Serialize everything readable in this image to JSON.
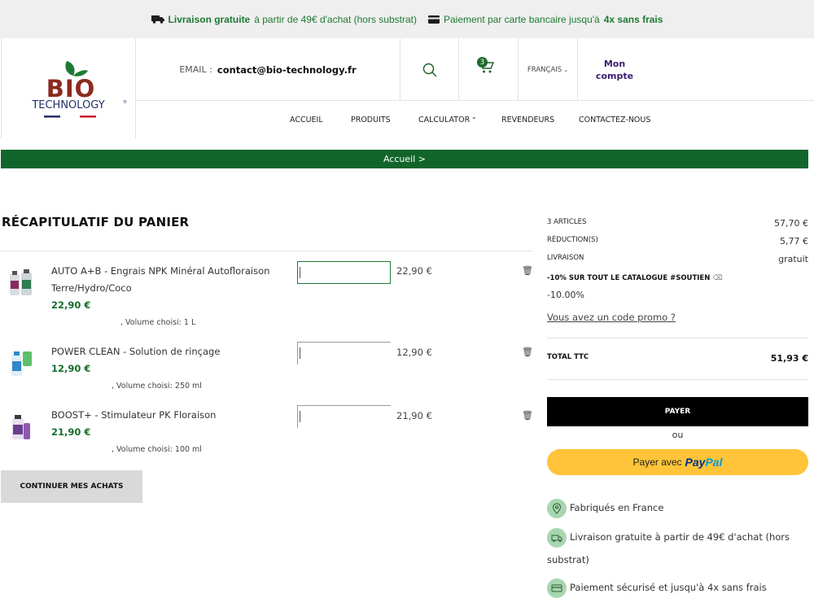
{
  "topbar": {
    "shipping_bold": "Livraison gratuite",
    "shipping_rest": "à partir de 49€ d'achat (hors substrat)",
    "payment_rest": "Paiement par carte bancaire jusqu'à",
    "payment_bold": "4x sans frais",
    "shipping_icon": "truck-icon",
    "payment_icon": "card-icon"
  },
  "header": {
    "logo": {
      "line1": "BIO",
      "line2": "TECHNOLOGY"
    },
    "email_label": "EMAIL :",
    "email_value": "contact@bio-technology.fr",
    "cart_count": "3",
    "language": "FRANÇAIS",
    "account_line1": "Mon",
    "account_line2": "compte"
  },
  "nav": {
    "items": [
      "ACCUEIL",
      "PRODUITS",
      "CALCULATOR",
      "REVENDEURS",
      "CONTACTEZ-NOUS"
    ]
  },
  "breadcrumb": "Accueil >",
  "cart": {
    "title": "RÉCAPITULATIF DU PANIER",
    "items": [
      {
        "name": "AUTO A+B - Engrais NPK Minéral Autofloraison Terre/Hydro/Coco",
        "price": "22,90 €",
        "variant": ", Volume choisi: 1 L",
        "total": "22,90 €"
      },
      {
        "name": "POWER CLEAN - Solution de rinçage",
        "price": "12,90 €",
        "variant": ", Volume choisi: 250 ml",
        "total": "12,90 €"
      },
      {
        "name": "BOOST+ - Stimulateur PK Floraison",
        "price": "21,90 €",
        "variant": ", Volume choisi: 100 ml",
        "total": "21,90 €"
      }
    ],
    "continue_label": "CONTINUER MES ACHATS"
  },
  "summary": {
    "articles_label": "3 ARTICLES",
    "articles_value": "57,70 €",
    "discount_label": "RÉDUCTION(S)",
    "discount_value": "5,77 €",
    "shipping_label": "LIVRAISON",
    "shipping_value": "gratuit",
    "promo_name": "-10% SUR TOUT LE CATALOGUE #SOUTIEN",
    "promo_pct": "-10.00%",
    "promo_link": "Vous avez un code promo ?",
    "total_label": "TOTAL TTC",
    "total_value": "51,93 €",
    "pay_label": "PAYER",
    "or_label": "ou",
    "paypal_prefix": "Payer avec",
    "paypal_brand1": "Pay",
    "paypal_brand2": "Pal"
  },
  "reassurance": [
    {
      "icon": "location-pin-icon",
      "text": "Fabriqués en France"
    },
    {
      "icon": "delivery-truck-icon",
      "text": "Livraison gratuite à partir de 49€ d'achat (hors substrat)"
    },
    {
      "icon": "credit-card-icon",
      "text": "Paiement sécurisé et jusqu'à 4x sans frais"
    }
  ],
  "colors": {
    "brand_green": "#11652a",
    "accent_purple": "#3b1d6e",
    "paypal_yellow": "#ffc439"
  }
}
